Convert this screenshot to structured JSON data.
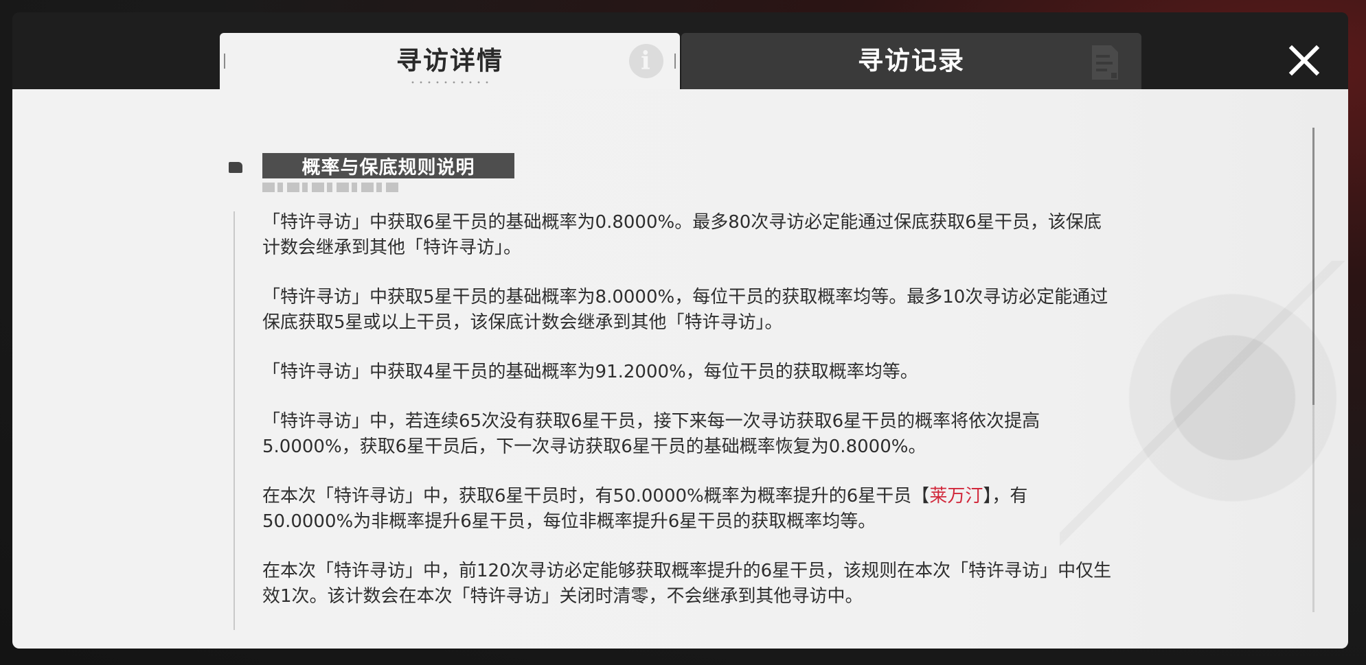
{
  "tabs": {
    "detail_label": "寻访详情",
    "record_label": "寻访记录"
  },
  "icons": {
    "info": "info-icon",
    "record": "document-icon",
    "close": "close-icon"
  },
  "section": {
    "title": "概率与保底规则说明"
  },
  "rules": [
    {
      "text": "「特许寻访」中获取6星干员的基础概率为0.8000%。最多80次寻访必定能通过保底获取6星干员，该保底计数会继承到其他「特许寻访」。"
    },
    {
      "text": "「特许寻访」中获取5星干员的基础概率为8.0000%，每位干员的获取概率均等。最多10次寻访必定能通过保底获取5星或以上干员，该保底计数会继承到其他「特许寻访」。"
    },
    {
      "text": "「特许寻访」中获取4星干员的基础概率为91.2000%，每位干员的获取概率均等。"
    },
    {
      "text": "「特许寻访」中，若连续65次没有获取6星干员，接下来每一次寻访获取6星干员的概率将依次提高5.0000%，获取6星干员后，下一次寻访获取6星干员的基础概率恢复为0.8000%。"
    },
    {
      "pre": "在本次「特许寻访」中，获取6星干员时，有50.0000%概率为概率提升的6星干员【",
      "highlight": "莱万汀",
      "post": "】，有50.0000%为非概率提升6星干员，每位非概率提升6星干员的获取概率均等。"
    },
    {
      "text": "在本次「特许寻访」中，前120次寻访必定能够获取概率提升的6星干员，该规则在本次「特许寻访」中仅生效1次。该计数会在本次「特许寻访」关闭时清零，不会继承到其他寻访中。"
    }
  ],
  "colors": {
    "highlight": "#d1273a",
    "active_tab": "#f2f2f2",
    "inactive_tab": "#3a3a3a",
    "section_title_bg": "#4e4e4e"
  }
}
